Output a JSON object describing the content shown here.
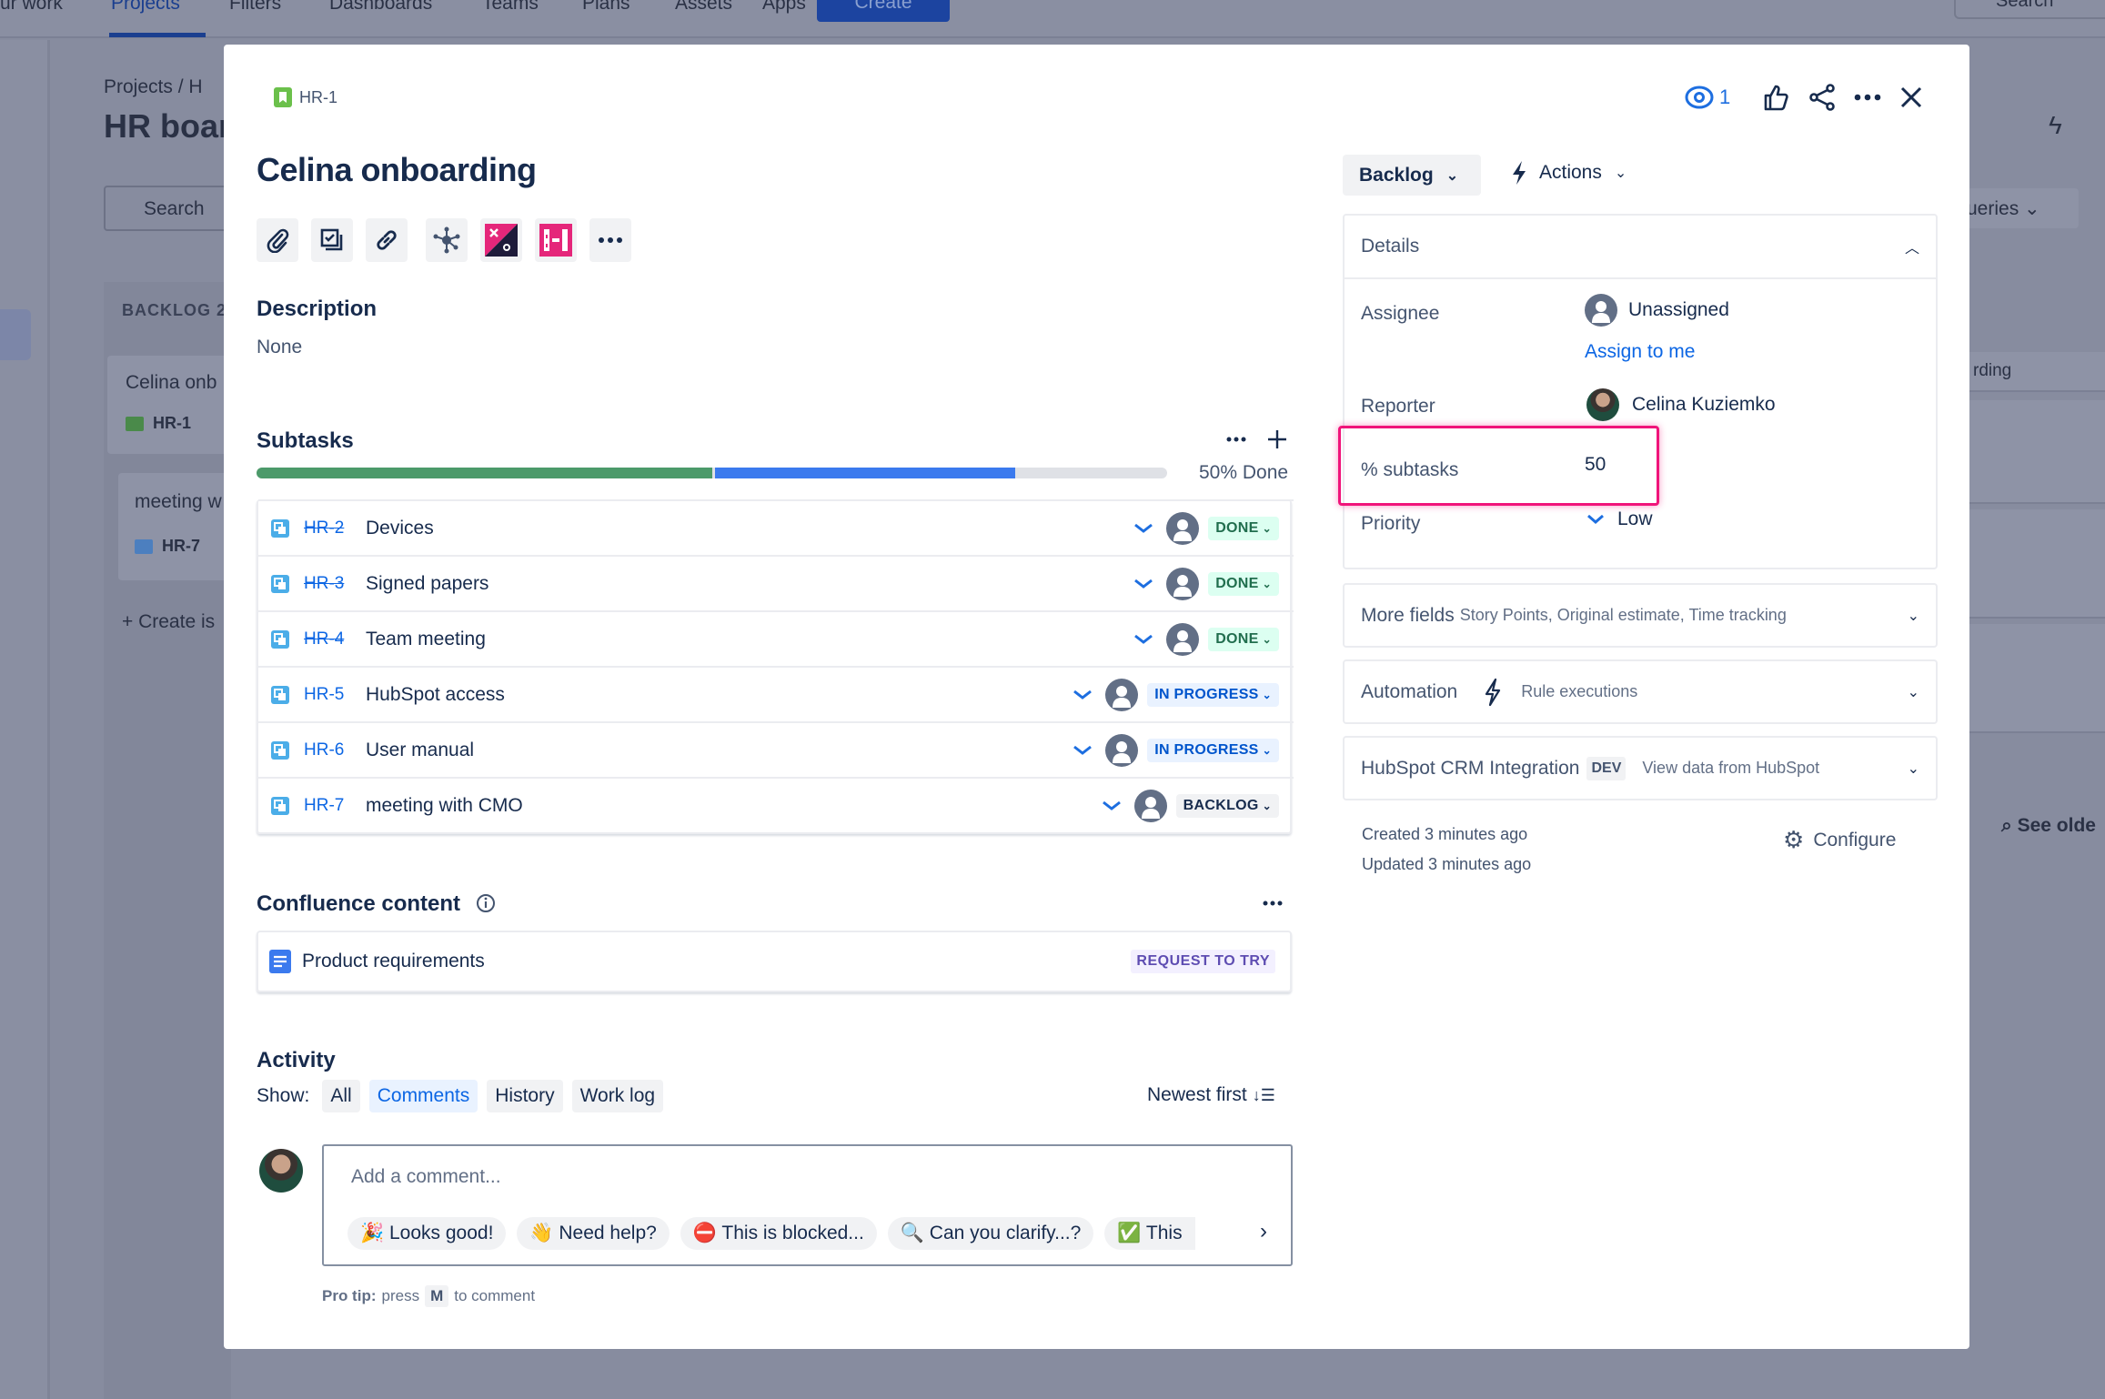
{
  "background": {
    "nav": [
      "ur work",
      "Projects",
      "Filters",
      "Dashboards",
      "Teams",
      "Plans",
      "Assets",
      "Apps"
    ],
    "create": "Create",
    "search": "Search",
    "breadcrumb": "Projects  /  H",
    "board_title": "HR boar",
    "board_search": "Search",
    "column": "BACKLOG 2",
    "card1_title": "Celina onb",
    "card1_key": "HR-1",
    "card2_title": "meeting w",
    "card2_key": "HR-7",
    "create_issue": "+ Create is",
    "queries": "ueries",
    "row_text": "rding",
    "see_older": "See olde"
  },
  "issue": {
    "key": "HR-1",
    "title": "Celina onboarding",
    "watchers": "1",
    "toolbar_icons": [
      "attachment-icon",
      "subtask-icon",
      "link-icon",
      "graph-icon",
      "app-x-icon",
      "app-board-icon",
      "more-icon"
    ],
    "description_label": "Description",
    "description": "None"
  },
  "subtasks": {
    "label": "Subtasks",
    "progress_done_pct": 50,
    "progress_inprogress_pct": 33.3,
    "progress_text": "50% Done",
    "items": [
      {
        "key": "HR-2",
        "summary": "Devices",
        "status": "DONE",
        "done": true
      },
      {
        "key": "HR-3",
        "summary": "Signed papers",
        "status": "DONE",
        "done": true
      },
      {
        "key": "HR-4",
        "summary": "Team meeting",
        "status": "DONE",
        "done": true
      },
      {
        "key": "HR-5",
        "summary": "HubSpot access",
        "status": "IN PROGRESS",
        "done": false
      },
      {
        "key": "HR-6",
        "summary": "User manual",
        "status": "IN PROGRESS",
        "done": false
      },
      {
        "key": "HR-7",
        "summary": "meeting with CMO",
        "status": "BACKLOG",
        "done": false
      }
    ],
    "status_colors": {
      "DONE": {
        "bg": "#dcfff1",
        "fg": "#216e4e"
      },
      "IN PROGRESS": {
        "bg": "#e9f2ff",
        "fg": "#0055cc"
      },
      "BACKLOG": {
        "bg": "#f1f2f4",
        "fg": "#172b4d"
      }
    }
  },
  "confluence": {
    "label": "Confluence content",
    "item": "Product requirements",
    "action": "REQUEST TO TRY"
  },
  "activity": {
    "label": "Activity",
    "show": "Show:",
    "filters": [
      "All",
      "Comments",
      "History",
      "Work log"
    ],
    "active_filter": "Comments",
    "sort": "Newest first",
    "comment_placeholder": "Add a comment...",
    "quick_replies": [
      "🎉 Looks good!",
      "👋 Need help?",
      "⛔ This is blocked...",
      "🔍 Can you clarify...?",
      "✅ This"
    ],
    "pro_tip_bold": "Pro tip:",
    "pro_tip_press": "press",
    "pro_tip_key": "M",
    "pro_tip_rest": "to comment"
  },
  "sidebar": {
    "status_button": "Backlog",
    "actions": "Actions",
    "details": "Details",
    "assignee_label": "Assignee",
    "assignee": "Unassigned",
    "assign_to_me": "Assign to me",
    "reporter_label": "Reporter",
    "reporter": "Celina Kuziemko",
    "subtasks_pct_label": "% subtasks",
    "subtasks_pct": "50",
    "priority_label": "Priority",
    "priority": "Low",
    "more_fields": "More fields",
    "more_fields_hint": "Story Points, Original estimate, Time tracking",
    "automation": "Automation",
    "automation_hint": "Rule executions",
    "hubspot": "HubSpot CRM Integration",
    "hubspot_badge": "DEV",
    "hubspot_hint": "View data from HubSpot",
    "created": "Created 3 minutes ago",
    "updated": "Updated 3 minutes ago",
    "configure": "Configure",
    "highlight_color": "#f0147a"
  }
}
